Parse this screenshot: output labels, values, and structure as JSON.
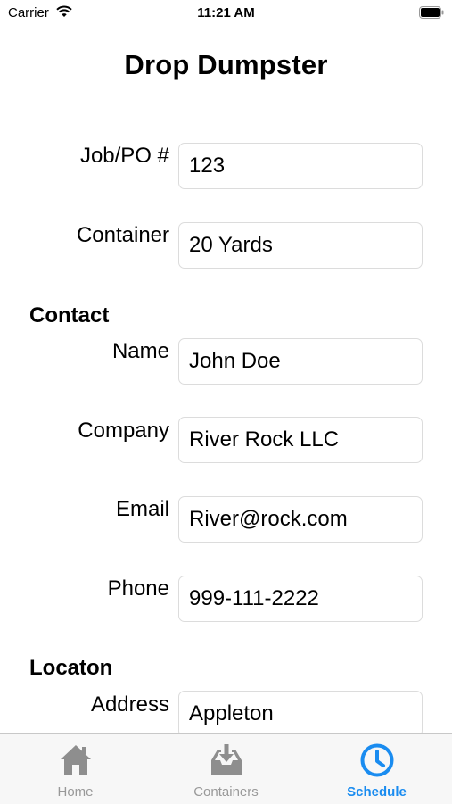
{
  "status_bar": {
    "carrier": "Carrier",
    "time": "11:21 AM"
  },
  "title": "Drop Dumpster",
  "fields": {
    "job_po": {
      "label": "Job/PO #",
      "value": "123"
    },
    "container": {
      "label": "Container",
      "value": "20 Yards"
    }
  },
  "contact": {
    "heading": "Contact",
    "name": {
      "label": "Name",
      "value": "John Doe"
    },
    "company": {
      "label": "Company",
      "value": "River Rock LLC"
    },
    "email": {
      "label": "Email",
      "value": "River@rock.com"
    },
    "phone": {
      "label": "Phone",
      "value": "999-111-2222"
    }
  },
  "location": {
    "heading": "Locaton",
    "address": {
      "label": "Address",
      "value": "Appleton"
    }
  },
  "tab_bar": {
    "tabs": [
      {
        "label": "Home",
        "icon": "house-icon",
        "active": false
      },
      {
        "label": "Containers",
        "icon": "tray-download-icon",
        "active": false
      },
      {
        "label": "Schedule",
        "icon": "clock-icon",
        "active": true
      }
    ]
  },
  "colors": {
    "accent": "#1a8cf0",
    "inactive_tab": "#999999",
    "input_border": "#dcdcdc"
  }
}
